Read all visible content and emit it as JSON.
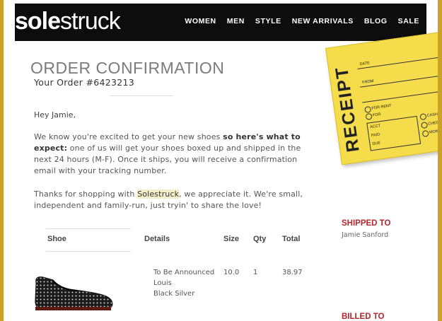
{
  "brand": {
    "logo_bold": "sole",
    "logo_light": "struck"
  },
  "nav": [
    "WOMEN",
    "MEN",
    "STYLE",
    "NEW ARRIVALS",
    "BLOG",
    "SALE"
  ],
  "header": {
    "title": "ORDER CONFIRMATION",
    "order_number": "Your Order #6423213"
  },
  "body": {
    "greeting": "Hey Jamie,",
    "p1_a": "We know you're excited to get your new shoes ",
    "p1_b": "so here's what to expect:",
    "p1_c": " one of us will get your shoes boxed up and shipped in the next 24 hours (M-F). Once it ships, you will receive a confirmation email with your tracking number.",
    "p2_a": "Thanks for shopping with ",
    "p2_b": "Solestruck",
    "p2_c": ", we appreciate it. We're small, independent and family-run, just tryin' to share the love!"
  },
  "receipt": {
    "word": "RECEIPT",
    "date": "DATE",
    "from": "FROM",
    "for_rent": "FOR RENT",
    "for": "FOR",
    "acct": "ACCT",
    "paid": "PAID",
    "due": "DUE",
    "cash": "CASH",
    "check": "CHECK",
    "money_order": "MONEY ORDER"
  },
  "table": {
    "headers": {
      "shoe": "Shoe",
      "details": "Details",
      "size": "Size",
      "qty": "Qty",
      "total": "Total"
    },
    "rows": [
      {
        "name": "To Be Announced",
        "model": "Louis",
        "color": "Black Silver",
        "size": "10.0",
        "qty": "1",
        "total": "38.97"
      }
    ]
  },
  "shipping": {
    "heading": "SHIPPED TO",
    "name": "Jamie Sanford"
  },
  "billing": {
    "heading": "BILLED TO"
  },
  "colors": {
    "accent": "#b1272b",
    "frame": "#c9a227",
    "receipt": "#f4dc4a"
  }
}
